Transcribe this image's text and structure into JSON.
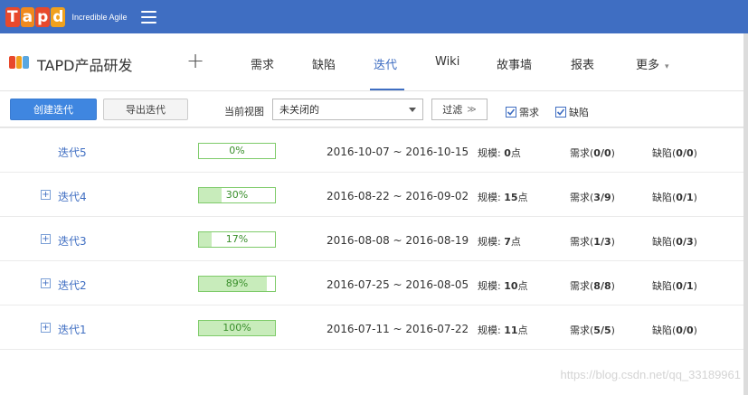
{
  "topbar": {
    "logo_letters": [
      {
        "char": "T",
        "color": "#e8492c"
      },
      {
        "char": "a",
        "color": "#f08a1d"
      },
      {
        "char": "p",
        "color": "#e8492c"
      },
      {
        "char": "d",
        "color": "#f0a11d"
      }
    ],
    "logo_tagline": "Incredible Agile",
    "menu_icon": "hamburger-menu-icon"
  },
  "project": {
    "icon_colors": [
      "#e8492c",
      "#f0a11d",
      "#59a7e0"
    ],
    "name": "TAPD产品研发",
    "add_symbol": "+"
  },
  "nav": {
    "items": [
      {
        "label": "需求",
        "active": false
      },
      {
        "label": "缺陷",
        "active": false
      },
      {
        "label": "迭代",
        "active": true
      },
      {
        "label": "Wiki",
        "active": false
      },
      {
        "label": "故事墙",
        "active": false
      },
      {
        "label": "报表",
        "active": false
      },
      {
        "label": "更多",
        "active": false,
        "caret": "▾"
      }
    ],
    "accent": "#3f6ec2"
  },
  "toolbar": {
    "create_label": "创建迭代",
    "export_label": "导出迭代",
    "view_label": "当前视图",
    "view_value": "未关闭的",
    "filter_label": "过滤",
    "filter_chevron": "≫",
    "checks": [
      {
        "label": "需求",
        "checked": true
      },
      {
        "label": "缺陷",
        "checked": true
      }
    ]
  },
  "iterations": [
    {
      "name": "迭代5",
      "expandable": false,
      "progress_label": "0%",
      "progress": 0,
      "dates": "2016-10-07 ~ 2016-10-15",
      "scale_prefix": "规模: ",
      "scale_value": "0",
      "scale_unit": "点",
      "req_prefix": "需求(",
      "req_value": "0/0",
      "req_suffix": ")",
      "bug_prefix": "缺陷(",
      "bug_value": "0/0",
      "bug_suffix": ")"
    },
    {
      "name": "迭代4",
      "expandable": true,
      "progress_label": "30%",
      "progress": 0.3,
      "dates": "2016-08-22 ~ 2016-09-02",
      "scale_prefix": "规模: ",
      "scale_value": "15",
      "scale_unit": "点",
      "req_prefix": "需求(",
      "req_value": "3/9",
      "req_suffix": ")",
      "bug_prefix": "缺陷(",
      "bug_value": "0/1",
      "bug_suffix": ")"
    },
    {
      "name": "迭代3",
      "expandable": true,
      "progress_label": "17%",
      "progress": 0.17,
      "dates": "2016-08-08 ~ 2016-08-19",
      "scale_prefix": "规模: ",
      "scale_value": "7",
      "scale_unit": "点",
      "req_prefix": "需求(",
      "req_value": "1/3",
      "req_suffix": ")",
      "bug_prefix": "缺陷(",
      "bug_value": "0/3",
      "bug_suffix": ")"
    },
    {
      "name": "迭代2",
      "expandable": true,
      "progress_label": "89%",
      "progress": 0.89,
      "dates": "2016-07-25 ~ 2016-08-05",
      "scale_prefix": "规模: ",
      "scale_value": "10",
      "scale_unit": "点",
      "req_prefix": "需求(",
      "req_value": "8/8",
      "req_suffix": ")",
      "bug_prefix": "缺陷(",
      "bug_value": "0/1",
      "bug_suffix": ")"
    },
    {
      "name": "迭代1",
      "expandable": true,
      "progress_label": "100%",
      "progress": 1.0,
      "dates": "2016-07-11 ~ 2016-07-22",
      "scale_prefix": "规模: ",
      "scale_value": "11",
      "scale_unit": "点",
      "req_prefix": "需求(",
      "req_value": "5/5",
      "req_suffix": ")",
      "bug_prefix": "缺陷(",
      "bug_value": "0/0",
      "bug_suffix": ")"
    }
  ],
  "watermark": "https://blog.csdn.net/qq_33189961"
}
